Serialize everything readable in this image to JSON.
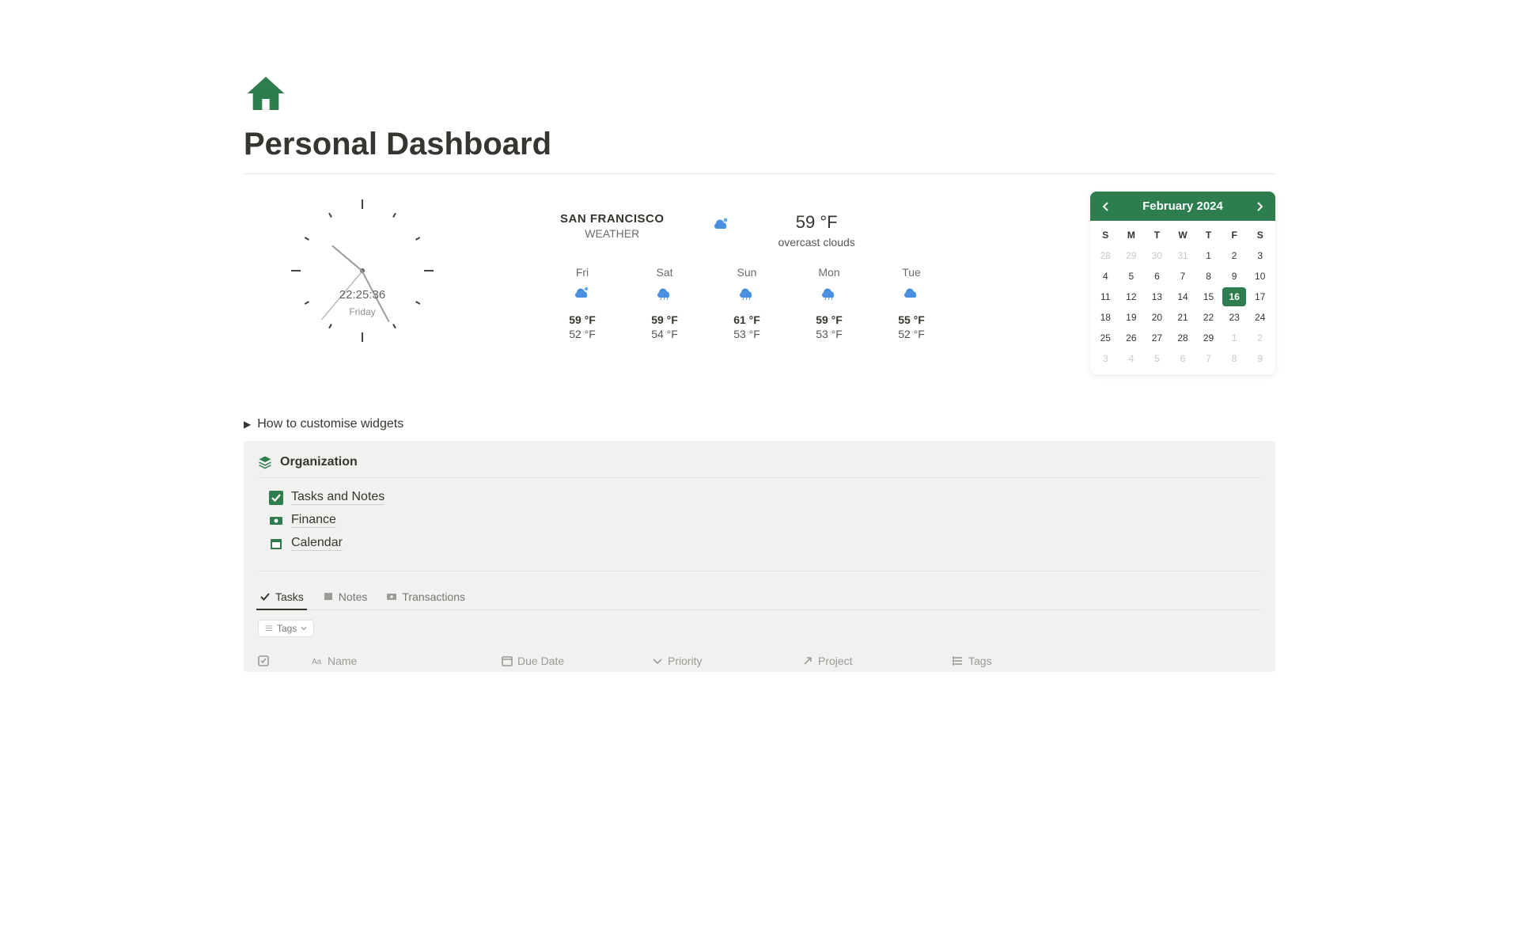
{
  "colors": {
    "accent": "#2d7d4f"
  },
  "page": {
    "title": "Personal Dashboard"
  },
  "clock": {
    "time": "22:25:36",
    "day": "Friday"
  },
  "weather": {
    "city": "SAN FRANCISCO",
    "subtitle": "WEATHER",
    "now_temp": "59 °F",
    "now_condition": "overcast clouds",
    "forecast": [
      {
        "day": "Fri",
        "icon": "cloud-partly",
        "hi": "59 °F",
        "lo": "52 °F"
      },
      {
        "day": "Sat",
        "icon": "cloud-rain",
        "hi": "59 °F",
        "lo": "54 °F"
      },
      {
        "day": "Sun",
        "icon": "cloud-rain",
        "hi": "61 °F",
        "lo": "53 °F"
      },
      {
        "day": "Mon",
        "icon": "cloud-rain",
        "hi": "59 °F",
        "lo": "53 °F"
      },
      {
        "day": "Tue",
        "icon": "cloud",
        "hi": "55 °F",
        "lo": "52 °F"
      }
    ]
  },
  "calendar": {
    "month_label": "February 2024",
    "dow": [
      "S",
      "M",
      "T",
      "W",
      "T",
      "F",
      "S"
    ],
    "cells": [
      {
        "n": "28",
        "muted": true
      },
      {
        "n": "29",
        "muted": true
      },
      {
        "n": "30",
        "muted": true
      },
      {
        "n": "31",
        "muted": true
      },
      {
        "n": "1"
      },
      {
        "n": "2"
      },
      {
        "n": "3"
      },
      {
        "n": "4"
      },
      {
        "n": "5"
      },
      {
        "n": "6"
      },
      {
        "n": "7"
      },
      {
        "n": "8"
      },
      {
        "n": "9"
      },
      {
        "n": "10"
      },
      {
        "n": "11"
      },
      {
        "n": "12"
      },
      {
        "n": "13"
      },
      {
        "n": "14"
      },
      {
        "n": "15"
      },
      {
        "n": "16",
        "today": true
      },
      {
        "n": "17"
      },
      {
        "n": "18"
      },
      {
        "n": "19"
      },
      {
        "n": "20"
      },
      {
        "n": "21"
      },
      {
        "n": "22"
      },
      {
        "n": "23"
      },
      {
        "n": "24"
      },
      {
        "n": "25"
      },
      {
        "n": "26"
      },
      {
        "n": "27"
      },
      {
        "n": "28"
      },
      {
        "n": "29"
      },
      {
        "n": "1",
        "muted": true
      },
      {
        "n": "2",
        "muted": true
      },
      {
        "n": "3",
        "muted": true
      },
      {
        "n": "4",
        "muted": true
      },
      {
        "n": "5",
        "muted": true
      },
      {
        "n": "6",
        "muted": true
      },
      {
        "n": "7",
        "muted": true
      },
      {
        "n": "8",
        "muted": true
      },
      {
        "n": "9",
        "muted": true
      }
    ]
  },
  "disclosure": {
    "label": "How to customise widgets"
  },
  "org": {
    "title": "Organization",
    "links": [
      {
        "label": "Tasks and Notes",
        "icon": "checkbox"
      },
      {
        "label": "Finance",
        "icon": "cash"
      },
      {
        "label": "Calendar",
        "icon": "calendar"
      }
    ],
    "tabs": [
      {
        "label": "Tasks",
        "icon": "check",
        "active": true
      },
      {
        "label": "Notes",
        "icon": "book",
        "active": false
      },
      {
        "label": "Transactions",
        "icon": "cash-sm",
        "active": false
      }
    ],
    "tags_chip": "Tags",
    "columns": [
      "Name",
      "Due Date",
      "Priority",
      "Project",
      "Tags"
    ]
  }
}
